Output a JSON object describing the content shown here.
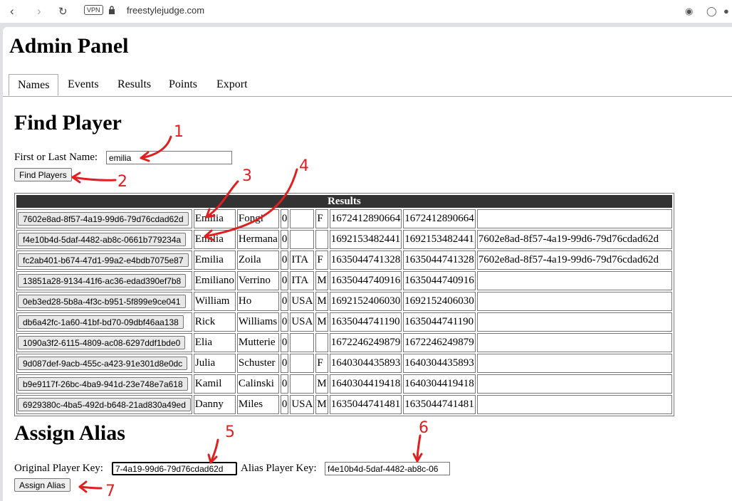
{
  "browser": {
    "vpn_label": "VPN",
    "url": "freestylejudge.com",
    "back_icon": "back-arrow-icon",
    "forward_icon": "forward-arrow-icon",
    "reload_icon": "reload-icon"
  },
  "page": {
    "title": "Admin Panel",
    "tabs": [
      "Names",
      "Events",
      "Results",
      "Points",
      "Export"
    ],
    "active_tab": "Names"
  },
  "find_player": {
    "heading": "Find Player",
    "name_label": "First or Last Name:",
    "name_value": "emilia",
    "button_label": "Find Players"
  },
  "results": {
    "header": "Results",
    "rows": [
      {
        "key": "7602e8ad-8f57-4a19-99d6-79d76cdad62d",
        "first": "Emilia",
        "last": "Fongi",
        "n": "0",
        "country": "",
        "gender": "F",
        "created": "1672412890664",
        "updated": "1672412890664",
        "alias": ""
      },
      {
        "key": "f4e10b4d-5daf-4482-ab8c-0661b779234a",
        "first": "Emilia",
        "last": "Hermana",
        "n": "0",
        "country": "",
        "gender": "",
        "created": "1692153482441",
        "updated": "1692153482441",
        "alias": "7602e8ad-8f57-4a19-99d6-79d76cdad62d"
      },
      {
        "key": "fc2ab401-b674-47d1-99a2-e4bdb7075e87",
        "first": "Emilia",
        "last": "Zoila",
        "n": "0",
        "country": "ITA",
        "gender": "F",
        "created": "1635044741328",
        "updated": "1635044741328",
        "alias": "7602e8ad-8f57-4a19-99d6-79d76cdad62d"
      },
      {
        "key": "13851a28-9134-41f6-ac36-edad390ef7b8",
        "first": "Emiliano",
        "last": "Verrino",
        "n": "0",
        "country": "ITA",
        "gender": "M",
        "created": "1635044740916",
        "updated": "1635044740916",
        "alias": ""
      },
      {
        "key": "0eb3ed28-5b8a-4f3c-b951-5f899e9ce041",
        "first": "William",
        "last": "Ho",
        "n": "0",
        "country": "USA",
        "gender": "M",
        "created": "1692152406030",
        "updated": "1692152406030",
        "alias": ""
      },
      {
        "key": "db6a42fc-1a60-41bf-bd70-09dbf46aa138",
        "first": "Rick",
        "last": "Williams",
        "n": "0",
        "country": "USA",
        "gender": "M",
        "created": "1635044741190",
        "updated": "1635044741190",
        "alias": ""
      },
      {
        "key": "1090a3f2-6115-4809-ac08-6297ddf1bde0",
        "first": "Elia",
        "last": "Mutterie",
        "n": "0",
        "country": "",
        "gender": "",
        "created": "1672246249879",
        "updated": "1672246249879",
        "alias": ""
      },
      {
        "key": "9d087def-9acb-455c-a423-91e301d8e0dc",
        "first": "Julia",
        "last": "Schuster",
        "n": "0",
        "country": "",
        "gender": "F",
        "created": "1640304435893",
        "updated": "1640304435893",
        "alias": ""
      },
      {
        "key": "b9e9117f-26bc-4ba9-941d-23e748e7a618",
        "first": "Kamil",
        "last": "Calinski",
        "n": "0",
        "country": "",
        "gender": "M",
        "created": "1640304419418",
        "updated": "1640304419418",
        "alias": ""
      },
      {
        "key": "6929380c-4ba5-492d-b648-21ad830a49ed",
        "first": "Danny",
        "last": "Miles",
        "n": "0",
        "country": "USA",
        "gender": "M",
        "created": "1635044741481",
        "updated": "1635044741481",
        "alias": ""
      }
    ]
  },
  "assign_alias": {
    "heading": "Assign Alias",
    "original_label": "Original Player Key:",
    "original_value": "7-4a19-99d6-79d76cdad62d",
    "alias_label": "Alias Player Key:",
    "alias_value": "f4e10b4d-5daf-4482-ab8c-06",
    "button_label": "Assign Alias"
  },
  "annotations": [
    "1",
    "2",
    "3",
    "4",
    "5",
    "6",
    "7"
  ],
  "colors": {
    "annotation": "#e02020",
    "table_header": "#333333"
  }
}
